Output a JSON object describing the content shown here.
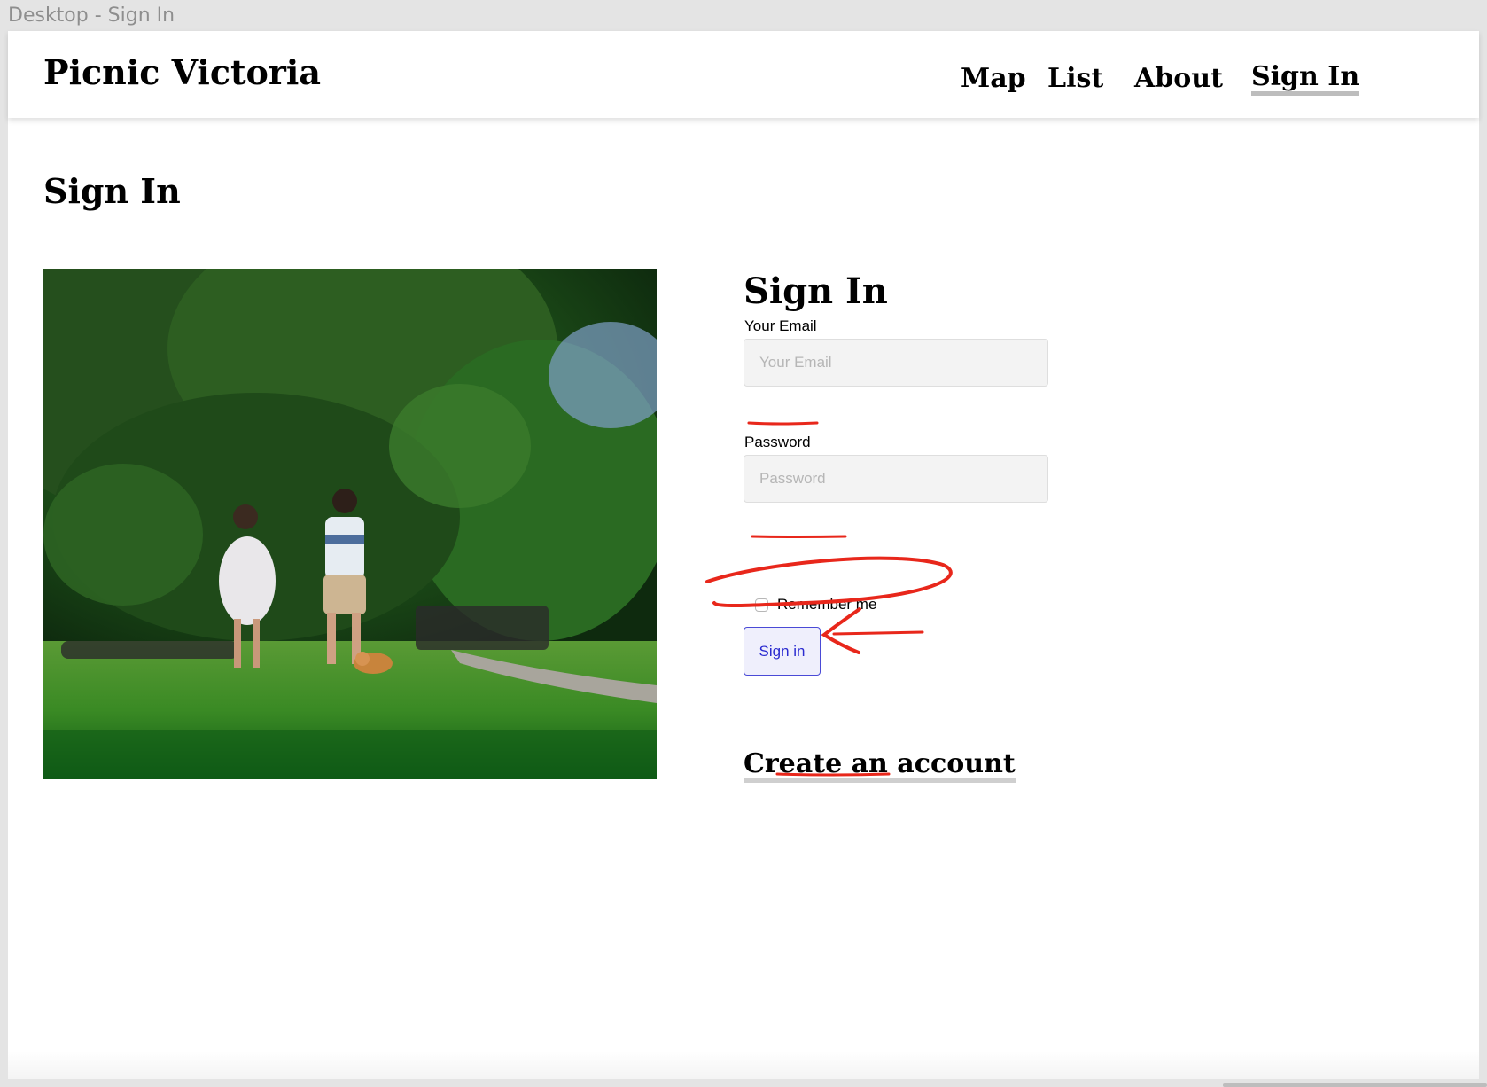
{
  "window": {
    "title": "Desktop - Sign In"
  },
  "navbar": {
    "brand": "Picnic Victoria",
    "links": [
      {
        "label": "Map"
      },
      {
        "label": "List"
      },
      {
        "label": "About"
      },
      {
        "label": "Sign In",
        "active": true
      }
    ]
  },
  "page": {
    "title": "Sign In"
  },
  "form": {
    "title": "Sign In",
    "email": {
      "label": "Your Email",
      "placeholder": "Your Email",
      "value": ""
    },
    "password": {
      "label": "Password",
      "placeholder": "Password",
      "value": ""
    },
    "remember": {
      "label": "Remember me",
      "checked": false
    },
    "submit_label": "Sign in",
    "create_account": "Create an account"
  },
  "colors": {
    "accent": "#2b2bd0",
    "annotation": "#e8271b",
    "input_bg": "#f3f3f3"
  },
  "image": {
    "subject": "park-photo",
    "icon": "photo-icon"
  }
}
